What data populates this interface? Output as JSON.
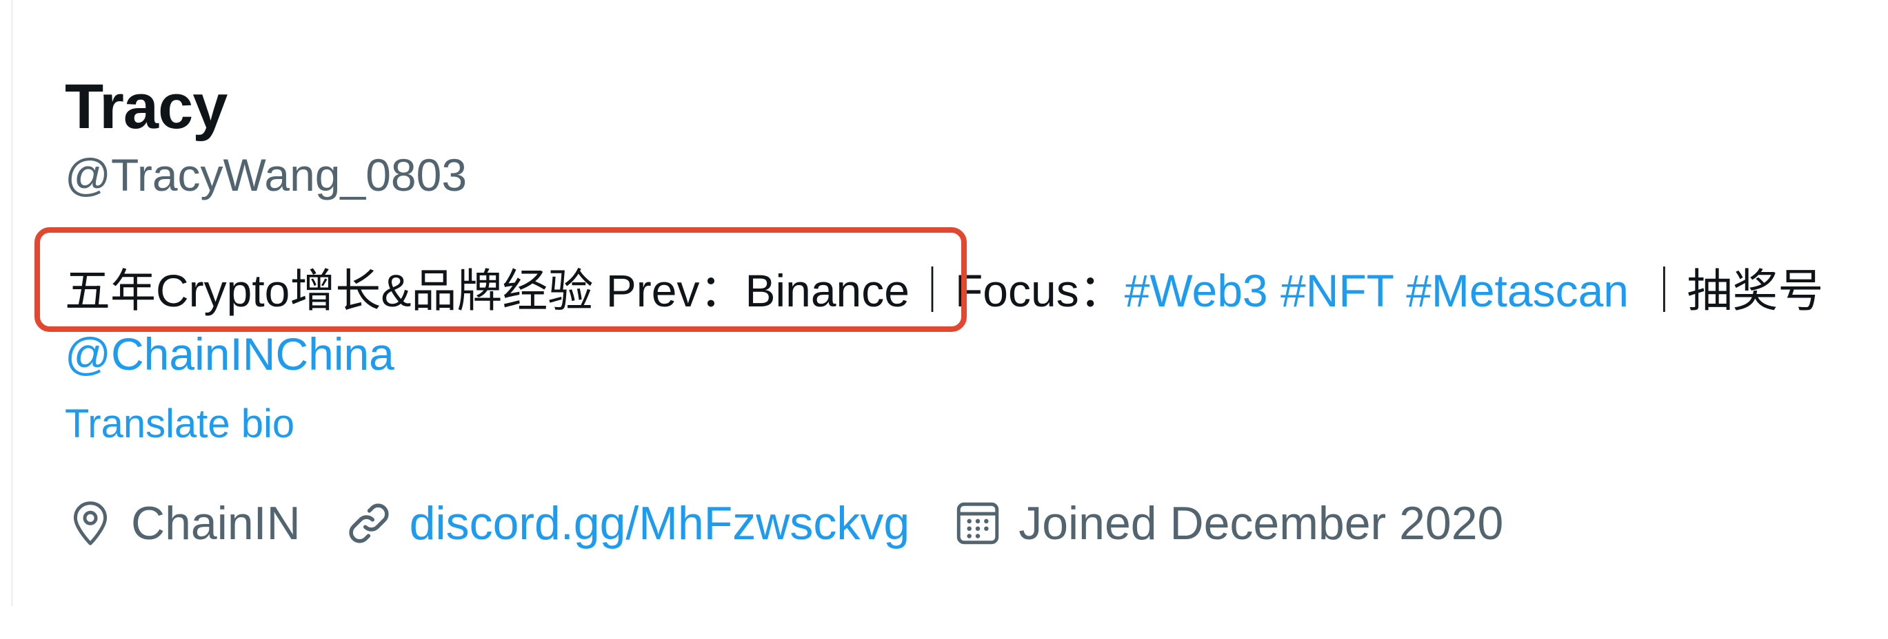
{
  "profile": {
    "display_name": "Tracy",
    "handle": "@TracyWang_0803"
  },
  "bio": {
    "part1": "五年Crypto增长&品牌经验 Prev：Binance",
    "separator1": "｜",
    "focus_label": "Focus：",
    "hashtag_web3": "#Web3",
    "hashtag_nft": "#NFT",
    "hashtag_metascan": "#Metascan",
    "separator2": "｜",
    "lottery_label": "抽奖号",
    "mention": "@ChainINChina"
  },
  "translate_bio": "Translate bio",
  "meta": {
    "location": "ChainIN",
    "website": "discord.gg/MhFzwsckvg",
    "joined": "Joined December 2020"
  },
  "colors": {
    "link": "#1d9bf0",
    "secondary_text": "#536471",
    "primary_text": "#0f1419",
    "highlight": "#e4472f"
  },
  "icons": {
    "location": "location-pin-icon",
    "website": "link-icon",
    "joined": "calendar-icon"
  }
}
